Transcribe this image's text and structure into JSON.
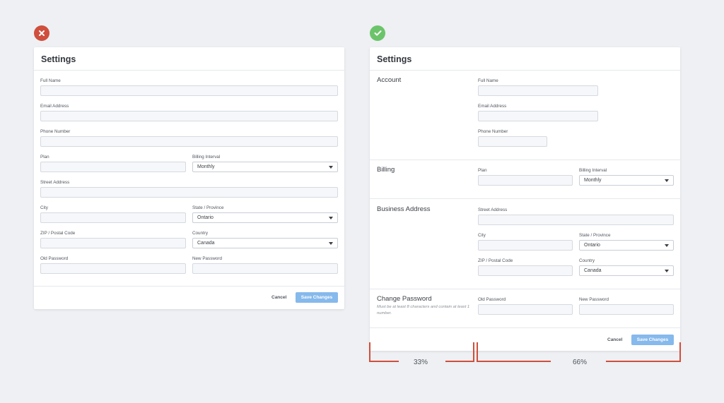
{
  "badges": {
    "bad": "x-icon",
    "good": "check-icon"
  },
  "left_form": {
    "title": "Settings",
    "labels": {
      "full_name": "Full Name",
      "email": "Email Address",
      "phone": "Phone Number",
      "plan": "Plan",
      "billing_interval": "Billing Interval",
      "street": "Street Address",
      "city": "City",
      "state": "State / Province",
      "zip": "ZIP / Postal Code",
      "country": "Country",
      "old_password": "Old Password",
      "new_password": "New Password"
    },
    "values": {
      "billing_interval": "Monthly",
      "state": "Ontario",
      "country": "Canada"
    },
    "cancel": "Cancel",
    "save": "Save Changes"
  },
  "right_form": {
    "title": "Settings",
    "sections": {
      "account": "Account",
      "billing": "Billing",
      "address": "Business Address",
      "password": "Change Password",
      "password_desc": "Must be at least 8 characters and contain at least 1 number."
    },
    "labels": {
      "full_name": "Full Name",
      "email": "Email Address",
      "phone": "Phone Number",
      "plan": "Plan",
      "billing_interval": "Billing Interval",
      "street": "Street Address",
      "city": "City",
      "state": "State / Province",
      "zip": "ZIP / Postal Code",
      "country": "Country",
      "old_password": "Old Password",
      "new_password": "New Password"
    },
    "values": {
      "billing_interval": "Monthly",
      "state": "Ontario",
      "country": "Canada"
    },
    "cancel": "Cancel",
    "save": "Save Changes"
  },
  "proportions": {
    "left": "33%",
    "right": "66%"
  },
  "colors": {
    "bad": "#cf4f3c",
    "good": "#6cc46a",
    "primary": "#86b9ec",
    "bracket": "#cf4f3c"
  }
}
